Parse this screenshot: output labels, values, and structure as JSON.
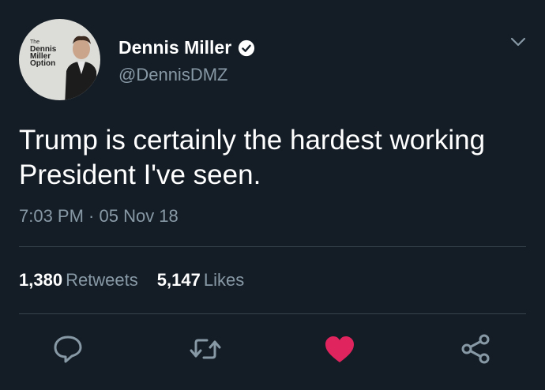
{
  "author": {
    "name": "Dennis Miller",
    "handle": "@DennisDMZ",
    "avatar_logo": [
      "The",
      "Dennis",
      "Miller",
      "Option"
    ]
  },
  "tweet": {
    "text": "Trump is certainly the hardest working President I've seen.",
    "timestamp": "7:03 PM · 05 Nov 18"
  },
  "stats": {
    "retweets_count": "1,380",
    "retweets_label": "Retweets",
    "likes_count": "5,147",
    "likes_label": "Likes"
  },
  "icons": {
    "verified": "verified-badge-icon",
    "menu": "chevron-down-icon",
    "reply": "reply-icon",
    "retweet": "retweet-icon",
    "like": "heart-icon",
    "share": "share-icon"
  },
  "colors": {
    "background": "#141d26",
    "secondary_text": "#8899a6",
    "like_active": "#e0245e",
    "divider": "#38444d"
  }
}
